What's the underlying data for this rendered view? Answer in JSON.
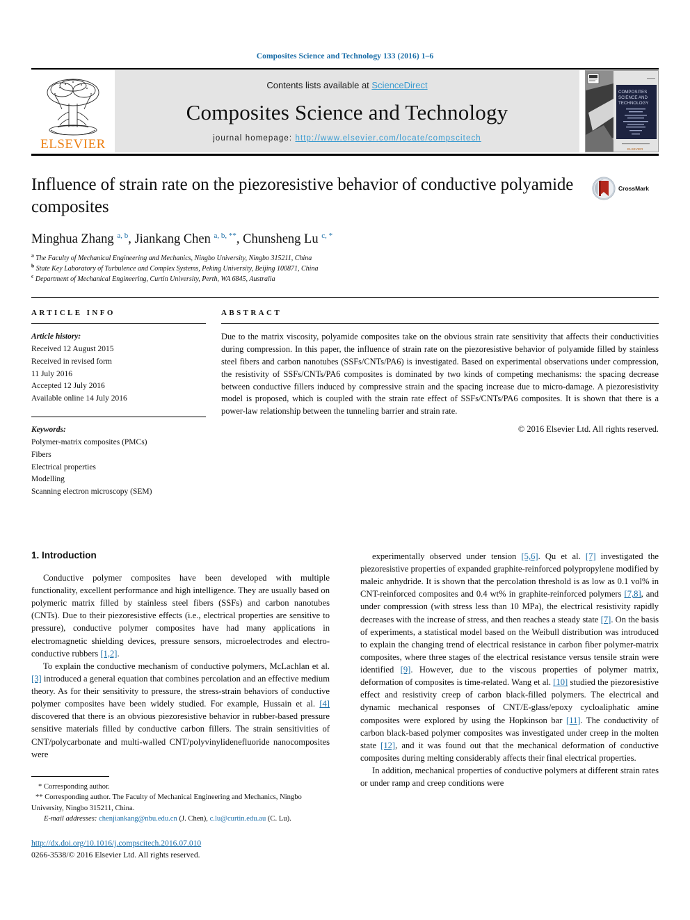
{
  "running_head": "Composites Science and Technology 133 (2016) 1–6",
  "masthead": {
    "contents_prefix": "Contents lists available at ",
    "sciencedirect": "ScienceDirect",
    "journal_title": "Composites Science and Technology",
    "homepage_label": "journal homepage: ",
    "homepage_url": "http://www.elsevier.com/locate/compscitech",
    "publisher_logo_text": "ELSEVIER",
    "cover_title_lines": [
      "COMPOSITES",
      "SCIENCE AND",
      "TECHNOLOGY"
    ],
    "link_color": "#3a9bd0",
    "band_color": "#e4e4e4",
    "elsevier_orange": "#ec8013"
  },
  "article": {
    "title": "Influence of strain rate on the piezoresistive behavior of conductive polyamide composites",
    "crossmark_label": "CrossMark",
    "authors_html": "Minghua Zhang <sup>a, b</sup>, Jiankang Chen <sup>a, b, **</sup>, Chunsheng Lu <sup>c, *</sup>",
    "affiliations": [
      {
        "marker": "a",
        "text": "The Faculty of Mechanical Engineering and Mechanics, Ningbo University, Ningbo 315211, China"
      },
      {
        "marker": "b",
        "text": "State Key Laboratory of Turbulence and Complex Systems, Peking University, Beijing 100871, China"
      },
      {
        "marker": "c",
        "text": "Department of Mechanical Engineering, Curtin University, Perth, WA 6845, Australia"
      }
    ]
  },
  "article_info": {
    "heading": "ARTICLE INFO",
    "history_label": "Article history:",
    "history": [
      "Received 12 August 2015",
      "Received in revised form",
      "11 July 2016",
      "Accepted 12 July 2016",
      "Available online 14 July 2016"
    ],
    "keywords_label": "Keywords:",
    "keywords": [
      "Polymer-matrix composites (PMCs)",
      "Fibers",
      "Electrical properties",
      "Modelling",
      "Scanning electron microscopy (SEM)"
    ]
  },
  "abstract": {
    "heading": "ABSTRACT",
    "text": "Due to the matrix viscosity, polyamide composites take on the obvious strain rate sensitivity that affects their conductivities during compression. In this paper, the influence of strain rate on the piezoresistive behavior of polyamide filled by stainless steel fibers and carbon nanotubes (SSFs/CNTs/PA6) is investigated. Based on experimental observations under compression, the resistivity of SSFs/CNTs/PA6 composites is dominated by two kinds of competing mechanisms: the spacing decrease between conductive fillers induced by compressive strain and the spacing increase due to micro-damage. A piezoresistivity model is proposed, which is coupled with the strain rate effect of SSFs/CNTs/PA6 composites. It is shown that there is a power-law relationship between the tunneling barrier and strain rate.",
    "copyright": "© 2016 Elsevier Ltd. All rights reserved."
  },
  "body": {
    "section_number_title": "1. Introduction",
    "left_paragraphs": [
      "Conductive polymer composites have been developed with multiple functionality, excellent performance and high intelligence. They are usually based on polymeric matrix filled by stainless steel fibers (SSFs) and carbon nanotubes (CNTs). Due to their piezoresistive effects (i.e., electrical properties are sensitive to pressure), conductive polymer composites have had many applications in electromagnetic shielding devices, pressure sensors, microelectrodes and electro-conductive rubbers [1,2].",
      "To explain the conductive mechanism of conductive polymers, McLachlan et al. [3] introduced a general equation that combines percolation and an effective medium theory. As for their sensitivity to pressure, the stress-strain behaviors of conductive polymer composites have been widely studied. For example, Hussain et al. [4] discovered that there is an obvious piezoresistive behavior in rubber-based pressure sensitive materials filled by conductive carbon fillers. The strain sensitivities of CNT/polycarbonate and multi-walled CNT/polyvinylidenefluoride nanocomposites were"
    ],
    "right_paragraphs": [
      "experimentally observed under tension [5,6]. Qu et al. [7] investigated the piezoresistive properties of expanded graphite-reinforced polypropylene modified by maleic anhydride. It is shown that the percolation threshold is as low as 0.1 vol% in CNT-reinforced composites and 0.4 wt% in graphite-reinforced polymers [7,8], and under compression (with stress less than 10 MPa), the electrical resistivity rapidly decreases with the increase of stress, and then reaches a steady state [7]. On the basis of experiments, a statistical model based on the Weibull distribution was introduced to explain the changing trend of electrical resistance in carbon fiber polymer-matrix composites, where three stages of the electrical resistance versus tensile strain were identified [9]. However, due to the viscous properties of polymer matrix, deformation of composites is time-related. Wang et al. [10] studied the piezoresistive effect and resistivity creep of carbon black-filled polymers. The electrical and dynamic mechanical responses of CNT/E-glass/epoxy cycloaliphatic amine composites were explored by using the Hopkinson bar [11]. The conductivity of carbon black-based polymer composites was investigated under creep in the molten state [12], and it was found out that the mechanical deformation of conductive composites during melting considerably affects their final electrical properties.",
      "In addition, mechanical properties of conductive polymers at different strain rates or under ramp and creep conditions were"
    ]
  },
  "footnotes": {
    "corresponding_1": "* Corresponding author.",
    "corresponding_2": "** Corresponding author. The Faculty of Mechanical Engineering and Mechanics, Ningbo University, Ningbo 315211, China.",
    "email_label": "E-mail addresses:",
    "email_1": "chenjiankang@nbu.edu.cn",
    "email_1_person": "(J. Chen),",
    "email_2": "c.lu@curtin.edu.au",
    "email_2_person": "(C. Lu).",
    "doi_url": "http://dx.doi.org/10.1016/j.compscitech.2016.07.010",
    "issn_line": "0266-3538/© 2016 Elsevier Ltd. All rights reserved."
  }
}
